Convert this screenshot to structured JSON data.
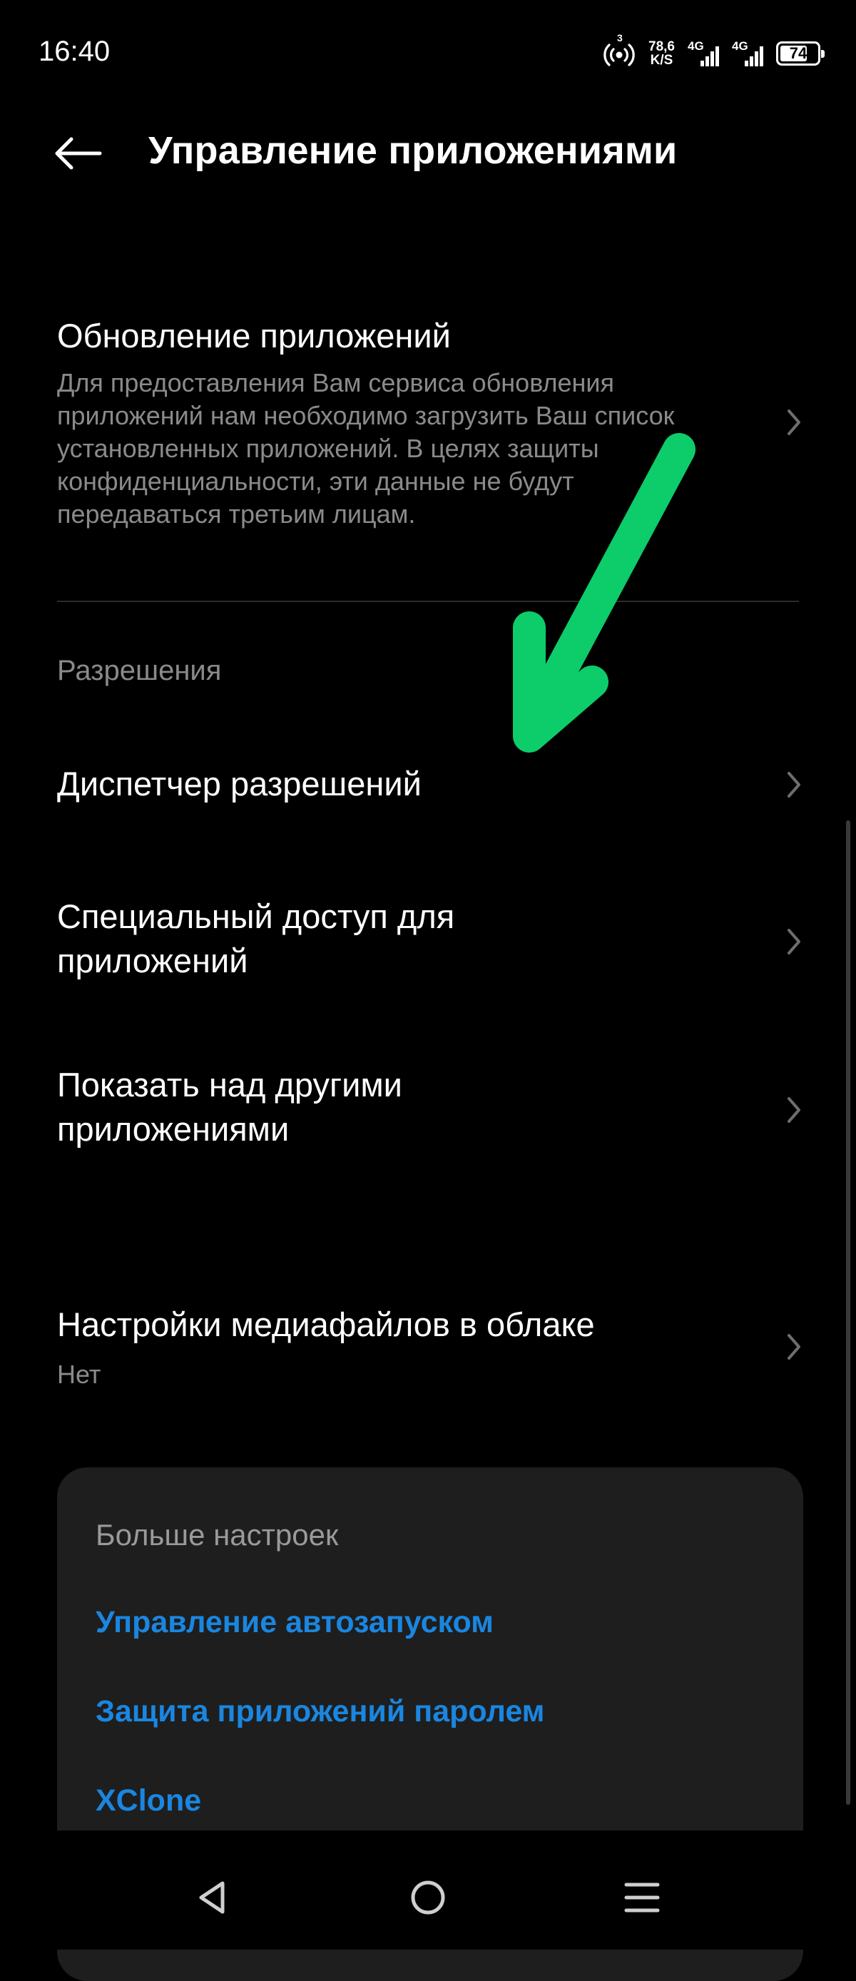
{
  "status_bar": {
    "time": "16:40",
    "hotspot_count": "3",
    "speed_value": "78,6",
    "speed_unit": "K/S",
    "network_1": "4G",
    "network_2": "4G",
    "battery_level": "74",
    "battery_fraction": 0.74
  },
  "header": {
    "back_icon": "arrow-left-icon",
    "title": "Управление приложениями"
  },
  "app_update": {
    "title": "Обновление приложений",
    "description": "Для предоставления Вам сервиса обновления приложений нам необходимо загрузить Ваш список установленных приложений. В целях защиты конфиденциальности, эти данные не будут передаваться третьим лицам."
  },
  "permissions_section": {
    "label": "Разрешения",
    "items": [
      {
        "title": "Диспетчер разрешений"
      },
      {
        "title": "Специальный доступ для приложений"
      },
      {
        "title": "Показать над другими приложениями"
      }
    ]
  },
  "cloud_media": {
    "title": "Настройки медиафайлов в облаке",
    "value": "Нет"
  },
  "more_settings": {
    "heading": "Больше настроек",
    "links": [
      {
        "label": "Управление автозапуском"
      },
      {
        "label": "Защита приложений паролем"
      },
      {
        "label": "XClone"
      }
    ]
  },
  "nav_bar": {
    "icons": [
      "back-triangle-icon",
      "home-circle-icon",
      "menu-lines-icon"
    ]
  },
  "colors": {
    "background": "#000000",
    "card": "#1e1e1e",
    "link": "#1a86e0",
    "secondary_text": "#8a8a8a",
    "annotation_arrow": "#0dcc6a"
  }
}
